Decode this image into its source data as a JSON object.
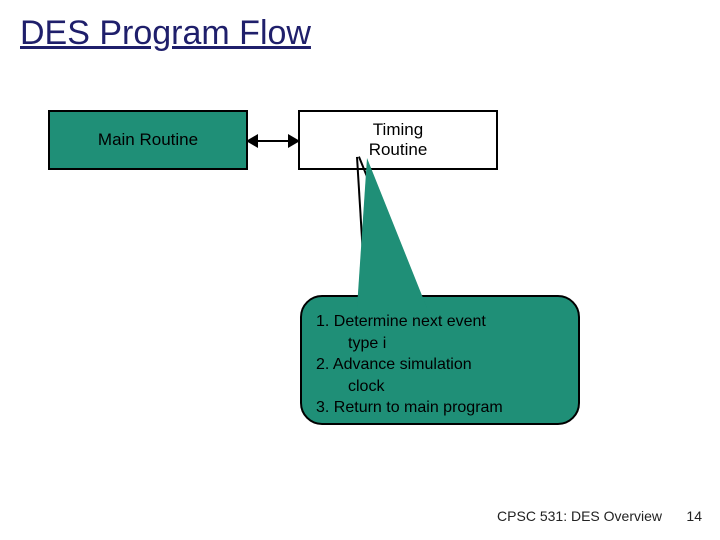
{
  "title": "DES Program Flow",
  "boxes": {
    "main_label": "Main Routine",
    "timing_label": "Timing\nRoutine"
  },
  "callout": {
    "line1": "1. Determine next event",
    "line1b": "type i",
    "line2": "2. Advance simulation",
    "line2b": "clock",
    "line3": "3. Return to main program"
  },
  "footer": {
    "course": "CPSC 531: DES Overview",
    "page": "14"
  }
}
